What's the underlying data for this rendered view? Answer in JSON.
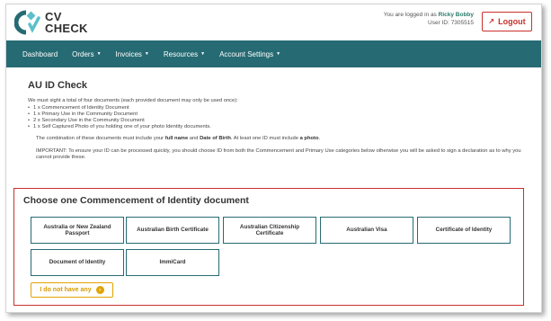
{
  "brand": {
    "line1": "CV",
    "line2": "CHECK",
    "primary_color": "#266b73",
    "accent_color": "#5bc0c9",
    "danger_color": "#c9302c",
    "warning_color": "#e0a300"
  },
  "header": {
    "logged_in_prefix": "You are logged in as",
    "user_name": "Ricky Bobby",
    "user_id_label": "User ID: 7305515",
    "logout_label": "Logout",
    "logout_icon": "sign-out-icon"
  },
  "nav": {
    "items": [
      {
        "label": "Dashboard",
        "has_caret": false
      },
      {
        "label": "Orders",
        "has_caret": true
      },
      {
        "label": "Invoices",
        "has_caret": true
      },
      {
        "label": "Resources",
        "has_caret": true
      },
      {
        "label": "Account Settings",
        "has_caret": true
      }
    ]
  },
  "page": {
    "title": "AU ID Check",
    "intro": "We must sight a total of four documents (each provided document may only be used once):",
    "requirements": [
      "1 x Commencement of Identity Document",
      "1 x Primary Use in the Community Document",
      "2 x Secondary Use in the Community Document",
      "1 x Self Captured Photo of you holding one of your photo Identity documents."
    ],
    "note_part1": "The combination of these documents must include your ",
    "note_bold1": "full name",
    "note_part2": " and ",
    "note_bold2": "Date of Birth",
    "note_part3": ". At least one ID must include ",
    "note_bold3": "a photo",
    "note_part4": ".",
    "important": "IMPORTANT: To ensure your ID can be processed quickly, you should choose ID from both the Commencement and Primary Use categories below otherwise you will be asked to sign a declaration as to why you cannot provide these."
  },
  "choose": {
    "title": "Choose one Commencement of Identity document",
    "documents": [
      "Australia or New Zealand Passport",
      "Australian Birth Certificate",
      "Australian Citizenship Certificate",
      "Australian Visa",
      "Certificate of Identity",
      "Document of Identity",
      "ImmiCard"
    ],
    "none_label": "I do not have any",
    "none_icon": "chevron-right-circle-icon"
  }
}
